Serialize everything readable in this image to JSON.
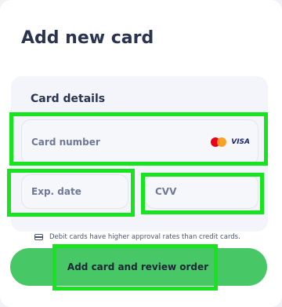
{
  "header": {
    "title": "Add new card"
  },
  "card_details": {
    "label": "Card details",
    "card_number_placeholder": "Card number",
    "card_brands": [
      "mastercard",
      "visa"
    ],
    "visa_text": "VISA",
    "exp_date_placeholder": "Exp. date",
    "cvv_placeholder": "CVV"
  },
  "notice": {
    "icon": "credit-card-icon",
    "text": "Debit cards have higher approval rates than credit cards."
  },
  "cta": {
    "label": "Add card and review order"
  },
  "colors": {
    "accent_green": "#48c766",
    "highlight_green": "#18e31f",
    "title_navy": "#2a3450"
  }
}
